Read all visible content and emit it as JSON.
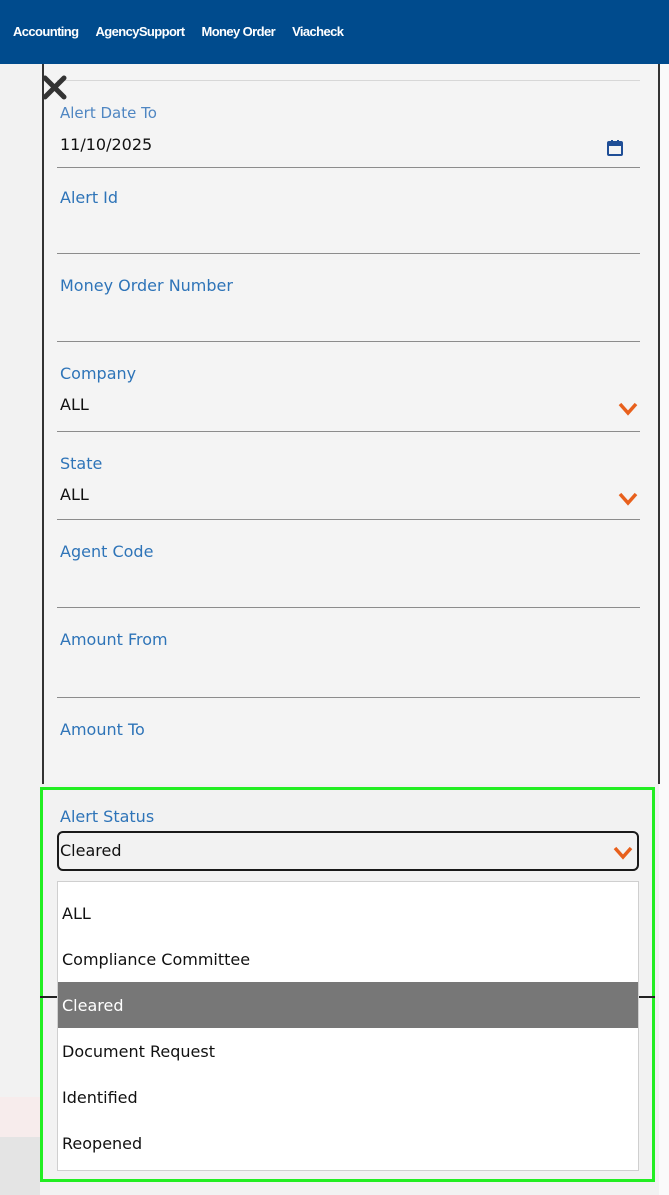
{
  "nav": {
    "items": [
      {
        "label": "Accounting"
      },
      {
        "label": "AgencySupport"
      },
      {
        "label": "Money Order"
      },
      {
        "label": "Viacheck"
      }
    ]
  },
  "form": {
    "alert_date_to": {
      "label": "Alert Date To",
      "value": "11/10/2025"
    },
    "alert_id": {
      "label": "Alert Id",
      "value": ""
    },
    "money_order_number": {
      "label": "Money Order Number",
      "value": ""
    },
    "company": {
      "label": "Company",
      "value": "ALL"
    },
    "state": {
      "label": "State",
      "value": "ALL"
    },
    "agent_code": {
      "label": "Agent Code",
      "value": ""
    },
    "amount_from": {
      "label": "Amount From",
      "value": ""
    },
    "amount_to": {
      "label": "Amount To",
      "value": ""
    },
    "alert_status": {
      "label": "Alert Status",
      "value": "Cleared",
      "options": [
        {
          "label": "ALL"
        },
        {
          "label": "Compliance Committee"
        },
        {
          "label": "Cleared",
          "selected": true
        },
        {
          "label": "Document Request"
        },
        {
          "label": "Identified"
        },
        {
          "label": "Reopened"
        }
      ]
    }
  },
  "colors": {
    "nav_bg": "#004b8d",
    "label": "#2e74b8",
    "accent_chevron": "#e8601c",
    "highlight_border": "#22ee22",
    "selected_option": "#777777"
  },
  "icons": {
    "close": "close-icon",
    "calendar": "calendar-icon",
    "dropdown": "chevron-down-icon"
  }
}
